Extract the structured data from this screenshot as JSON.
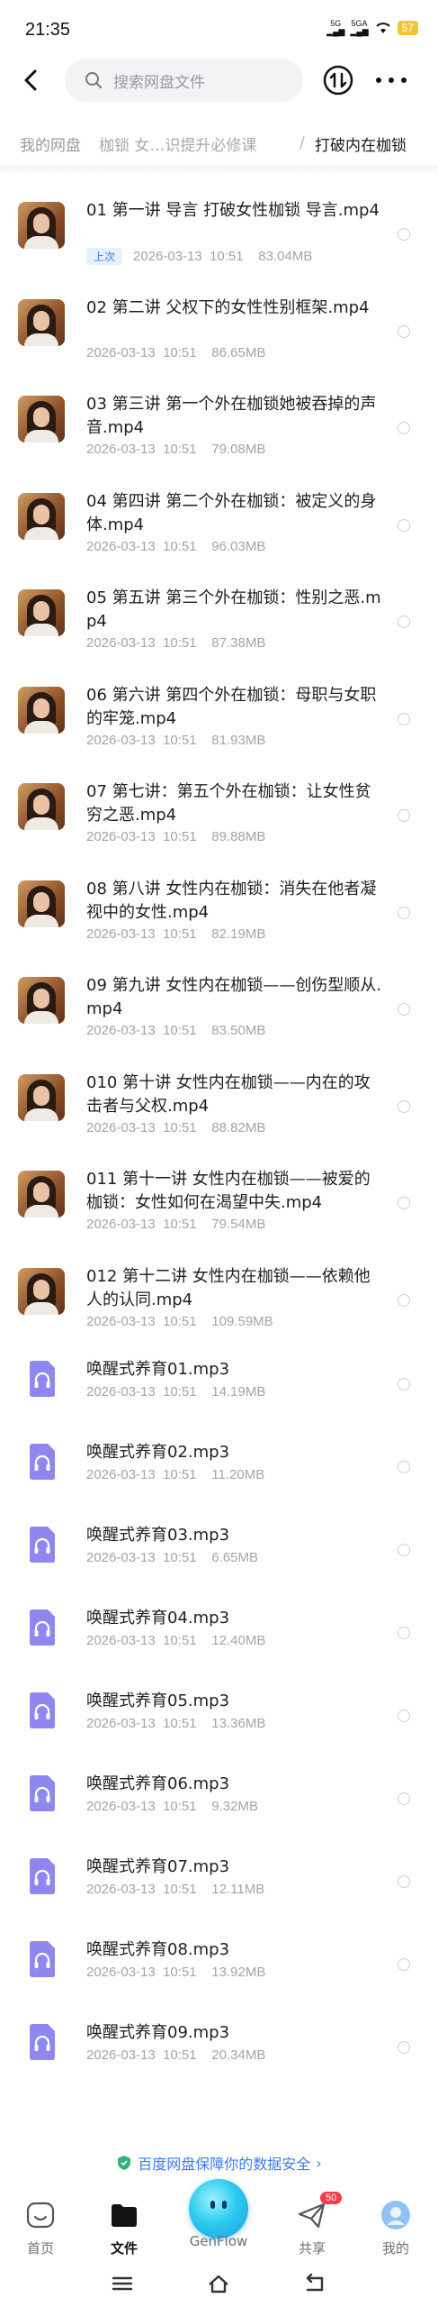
{
  "status": {
    "time": "21:35",
    "sig1": "5G",
    "sig2": "5GA",
    "battery": "57"
  },
  "search": {
    "placeholder": "搜索网盘文件"
  },
  "breadcrumb": {
    "root": "我的网盘",
    "middle": "枷锁 女…识提升必修课",
    "sep": "/",
    "current": "打破内在枷锁"
  },
  "files": [
    {
      "name": "01 第一讲 导言 打破女性枷锁 导言.mp4",
      "date": "2026-03-13  10:51",
      "size": "83.04MB",
      "badge": "上次",
      "type": "video"
    },
    {
      "name": "02 第二讲 父权下的女性性别框架.mp4",
      "date": "2026-03-13  10:51",
      "size": "86.65MB",
      "type": "video"
    },
    {
      "name": "03 第三讲 第一个外在枷锁她被吞掉的声音.mp4",
      "date": "2026-03-13  10:51",
      "size": "79.08MB",
      "type": "video"
    },
    {
      "name": "04 第四讲 第二个外在枷锁：被定义的身体.mp4",
      "date": "2026-03-13  10:51",
      "size": "96.03MB",
      "type": "video"
    },
    {
      "name": "05 第五讲 第三个外在枷锁：性别之恶.mp4",
      "date": "2026-03-13  10:51",
      "size": "87.38MB",
      "type": "video"
    },
    {
      "name": "06 第六讲 第四个外在枷锁：母职与女职的牢笼.mp4",
      "date": "2026-03-13  10:51",
      "size": "81.93MB",
      "type": "video"
    },
    {
      "name": "07 第七讲：第五个外在枷锁：让女性贫穷之恶.mp4",
      "date": "2026-03-13  10:51",
      "size": "89.88MB",
      "type": "video"
    },
    {
      "name": "08 第八讲 女性内在枷锁：消失在他者凝视中的女性.mp4",
      "date": "2026-03-13  10:51",
      "size": "82.19MB",
      "type": "video"
    },
    {
      "name": "09 第九讲 女性内在枷锁——创伤型顺从.mp4",
      "date": "2026-03-13  10:51",
      "size": "83.50MB",
      "type": "video"
    },
    {
      "name": "010 第十讲 女性内在枷锁——内在的攻击者与父权.mp4",
      "date": "2026-03-13  10:51",
      "size": "88.82MB",
      "type": "video"
    },
    {
      "name": "011 第十一讲 女性内在枷锁——被爱的枷锁：女性如何在渴望中失.mp4",
      "date": "2026-03-13  10:51",
      "size": "79.54MB",
      "type": "video"
    },
    {
      "name": "012 第十二讲 女性内在枷锁——依赖他人的认同.mp4",
      "date": "2026-03-13  10:51",
      "size": "109.59MB",
      "type": "video"
    },
    {
      "name": "唤醒式养育01.mp3",
      "date": "2026-03-13  10:51",
      "size": "14.19MB",
      "type": "audio"
    },
    {
      "name": "唤醒式养育02.mp3",
      "date": "2026-03-13  10:51",
      "size": "11.20MB",
      "type": "audio"
    },
    {
      "name": "唤醒式养育03.mp3",
      "date": "2026-03-13  10:51",
      "size": "6.65MB",
      "type": "audio"
    },
    {
      "name": "唤醒式养育04.mp3",
      "date": "2026-03-13  10:51",
      "size": "12.40MB",
      "type": "audio"
    },
    {
      "name": "唤醒式养育05.mp3",
      "date": "2026-03-13  10:51",
      "size": "13.36MB",
      "type": "audio"
    },
    {
      "name": "唤醒式养育06.mp3",
      "date": "2026-03-13  10:51",
      "size": "9.32MB",
      "type": "audio"
    },
    {
      "name": "唤醒式养育07.mp3",
      "date": "2026-03-13  10:51",
      "size": "12.11MB",
      "type": "audio"
    },
    {
      "name": "唤醒式养育08.mp3",
      "date": "2026-03-13  10:51",
      "size": "13.92MB",
      "type": "audio"
    },
    {
      "name": "唤醒式养育09.mp3",
      "date": "2026-03-13  10:51",
      "size": "20.34MB",
      "type": "audio"
    }
  ],
  "safety": {
    "text": "百度网盘保障你的数据安全",
    "arrow": "›"
  },
  "tabs": {
    "home": "首页",
    "files": "文件",
    "genflow": "GenFlow",
    "share": "共享",
    "share_badge": "50",
    "me": "我的"
  },
  "colors": {
    "accent": "#3b7bf6",
    "audio_icon": "#8f87ef",
    "badge_red": "#ff3b4a"
  }
}
